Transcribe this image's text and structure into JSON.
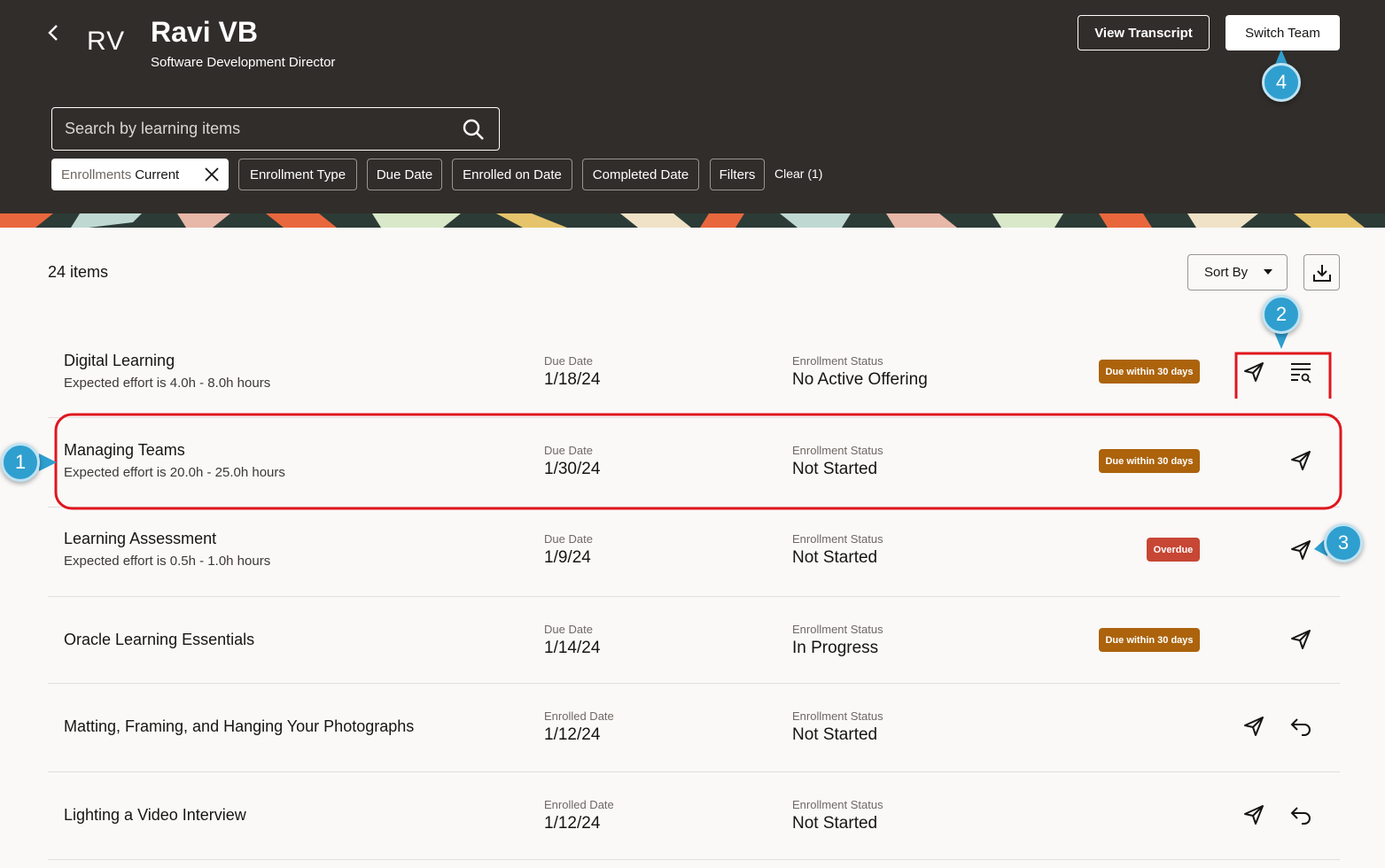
{
  "header": {
    "avatar_initials": "RV",
    "name": "Ravi VB",
    "role": "Software Development Director",
    "view_transcript": "View Transcript",
    "switch_team": "Switch Team",
    "search_placeholder": "Search by learning items"
  },
  "filters": {
    "active_chip_label": "Enrollments",
    "active_chip_value": "Current",
    "chips": [
      "Enrollment Type",
      "Due Date",
      "Enrolled on Date",
      "Completed Date",
      "Filters"
    ],
    "clear": "Clear (1)"
  },
  "list": {
    "count": "24 items",
    "sort_by": "Sort By",
    "rows": [
      {
        "title": "Digital Learning",
        "subtitle": "Expected effort is 4.0h - 8.0h hours",
        "date_label": "Due Date",
        "date": "1/18/24",
        "status_label": "Enrollment Status",
        "status": "No Active Offering",
        "badge": "Due within 30 days"
      },
      {
        "title": "Managing Teams",
        "subtitle": "Expected effort is 20.0h - 25.0h hours",
        "date_label": "Due Date",
        "date": "1/30/24",
        "status_label": "Enrollment Status",
        "status": "Not Started",
        "badge": "Due within 30 days"
      },
      {
        "title": "Learning Assessment",
        "subtitle": "Expected effort is 0.5h - 1.0h hours",
        "date_label": "Due Date",
        "date": "1/9/24",
        "status_label": "Enrollment Status",
        "status": "Not Started",
        "badge": "Overdue"
      },
      {
        "title": "Oracle Learning Essentials",
        "date_label": "Due Date",
        "date": "1/14/24",
        "status_label": "Enrollment Status",
        "status": "In Progress",
        "badge": "Due within 30 days"
      },
      {
        "title": "Matting, Framing, and Hanging Your Photographs",
        "date_label": "Enrolled Date",
        "date": "1/12/24",
        "status_label": "Enrollment Status",
        "status": "Not Started"
      },
      {
        "title": "Lighting a Video Interview",
        "date_label": "Enrolled Date",
        "date": "1/12/24",
        "status_label": "Enrollment Status",
        "status": "Not Started"
      }
    ]
  },
  "callouts": [
    "1",
    "2",
    "3",
    "4"
  ],
  "colors": {
    "header_bg": "#312d2a",
    "badge_warning": "#ac630c",
    "badge_overdue": "#c74634",
    "callout": "#2f9fcf",
    "highlight": "#e0161e"
  }
}
